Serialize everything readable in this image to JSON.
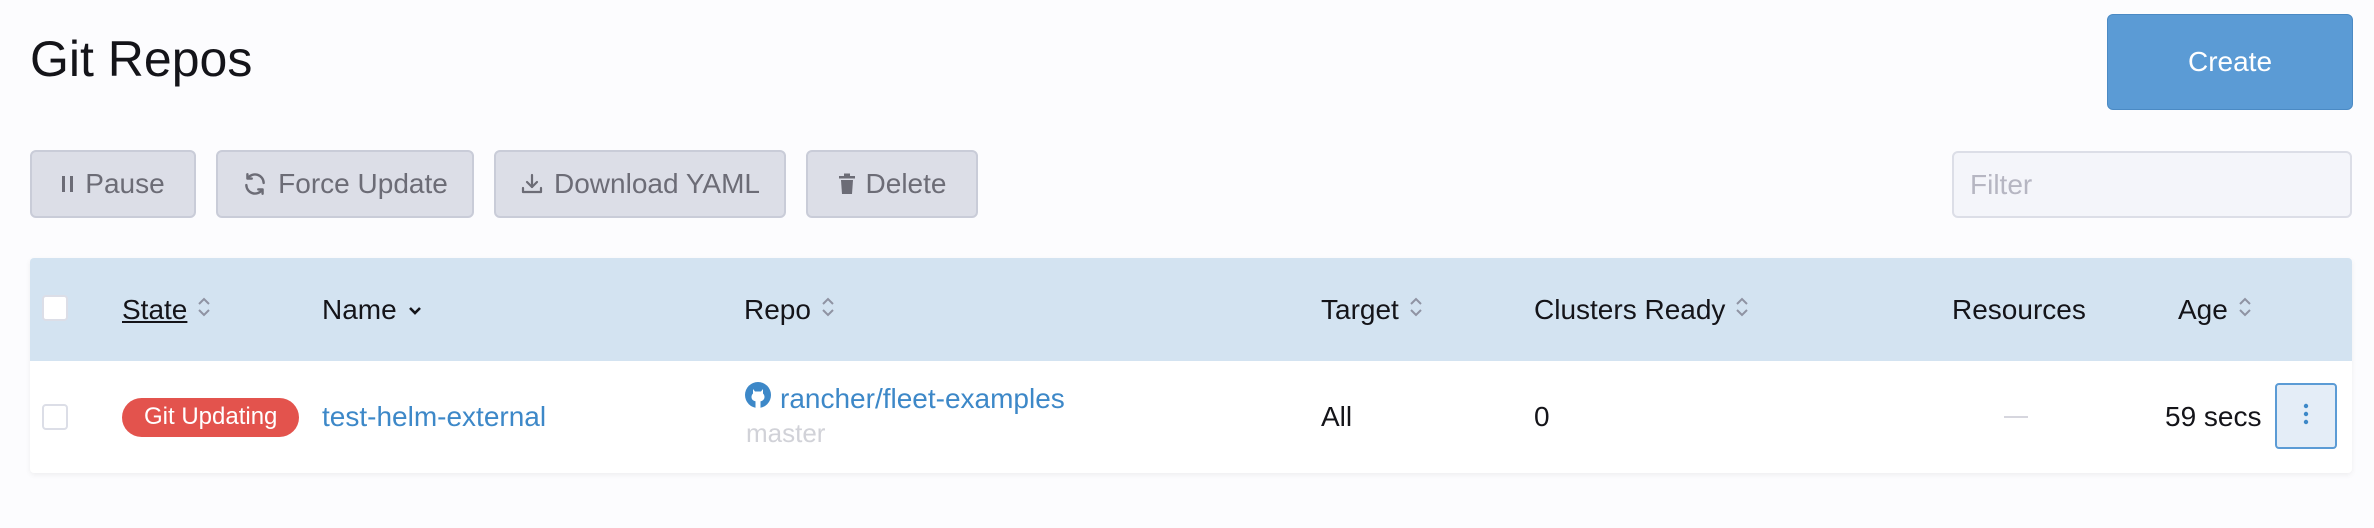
{
  "page": {
    "title": "Git Repos"
  },
  "header": {
    "create_label": "Create"
  },
  "toolbar": {
    "pause_label": "Pause",
    "force_update_label": "Force Update",
    "download_yaml_label": "Download YAML",
    "delete_label": "Delete",
    "filter_placeholder": "Filter",
    "filter_value": ""
  },
  "table": {
    "columns": {
      "state": "State",
      "name": "Name",
      "repo": "Repo",
      "target": "Target",
      "clusters_ready": "Clusters Ready",
      "resources": "Resources",
      "age": "Age"
    },
    "rows": [
      {
        "state": "Git Updating",
        "name": "test-helm-external",
        "repo": "rancher/fleet-examples",
        "branch": "master",
        "target": "All",
        "clusters_ready": "0",
        "resources": "—",
        "age": "59 secs"
      }
    ]
  },
  "icons": {
    "pause": "pause-icon",
    "force_update": "refresh-icon",
    "download": "download-icon",
    "delete": "trash-icon",
    "repo": "github-icon",
    "sort": "sort-icon",
    "menu": "vertical-dots-icon"
  },
  "colors": {
    "accent": "#5b9bd5",
    "link": "#3d88c8",
    "status_error": "#e3534d",
    "table_header": "#d3e3f1"
  }
}
